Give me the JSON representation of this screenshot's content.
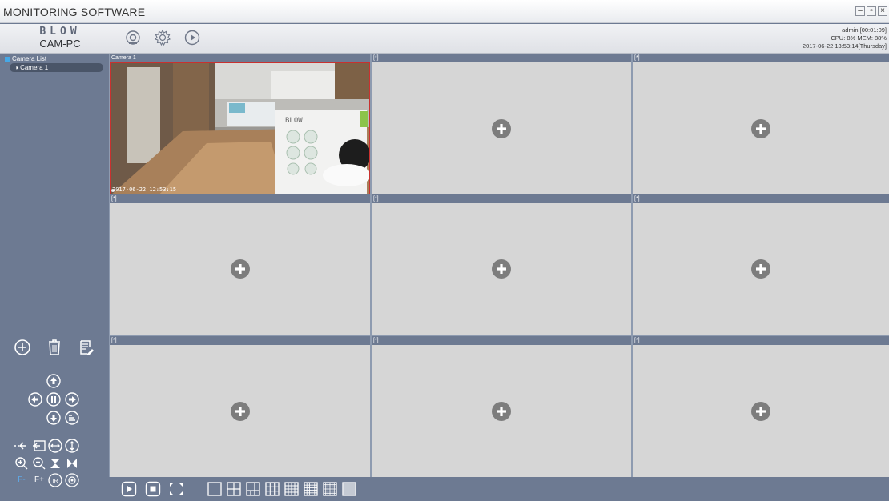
{
  "window": {
    "title": "MONITORING SOFTWARE",
    "buttons": [
      "–",
      "▫",
      "×"
    ]
  },
  "toolbar": {
    "brand": "BLOW",
    "app_name": "CAM-PC",
    "user": "admin  [00:01:09]",
    "cpu_mem": "CPU: 8%  MEM: 88%",
    "datetime": "2017-06-22 13:53:14[Thursday]"
  },
  "sidebar": {
    "tree_root": "Camera List",
    "cameras": [
      "Camera 1"
    ]
  },
  "grid": {
    "cells": [
      {
        "header": "Camera 1",
        "timestamp": "2017-06-22  12:53:15"
      },
      {
        "header": "[*]"
      },
      {
        "header": "[*]"
      },
      {
        "header": "[*]"
      },
      {
        "header": "[*]"
      },
      {
        "header": "[*]"
      },
      {
        "header": "[*]"
      },
      {
        "header": "[*]"
      },
      {
        "header": "[*]"
      }
    ]
  },
  "ptz": {
    "focus_minus": "F-",
    "focus_plus": "F+"
  },
  "colors": {
    "panel": "#6d7a92",
    "cell_bg": "#d6d6d6",
    "selected_border": "#c9312f",
    "tree_item_bg": "#4a5568"
  }
}
